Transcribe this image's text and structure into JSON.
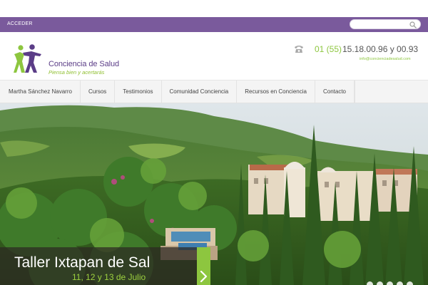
{
  "topbar": {
    "login_label": "ACCEDER",
    "search_placeholder": "",
    "search_icon": "search-icon",
    "background": "#7a5a9c"
  },
  "header": {
    "logo": {
      "name": "Conciencia de Salud",
      "tagline": "Piensa bien y acertarás",
      "icon": "people-logo-icon",
      "colors": [
        "#8dc63f",
        "#5b3d87"
      ]
    },
    "contact": {
      "phone_icon": "phone-icon",
      "phone_prefix": "01 (55)",
      "phone_number": "15.18.00.96 y 00.93",
      "email": "info@concienciadesalud.com"
    }
  },
  "nav": {
    "items": [
      {
        "label": "Martha Sánchez Navarro"
      },
      {
        "label": "Cursos"
      },
      {
        "label": "Testimonios"
      },
      {
        "label": "Comunidad Conciencia"
      },
      {
        "label": "Recursos en Conciencia"
      },
      {
        "label": "Contacto"
      }
    ]
  },
  "hero": {
    "slide_title": "Taller Ixtapan de Sal",
    "slide_date": "11, 12 y 13 de Julio",
    "next_icon": "chevron-right-icon",
    "accent": "#8dc63f"
  }
}
